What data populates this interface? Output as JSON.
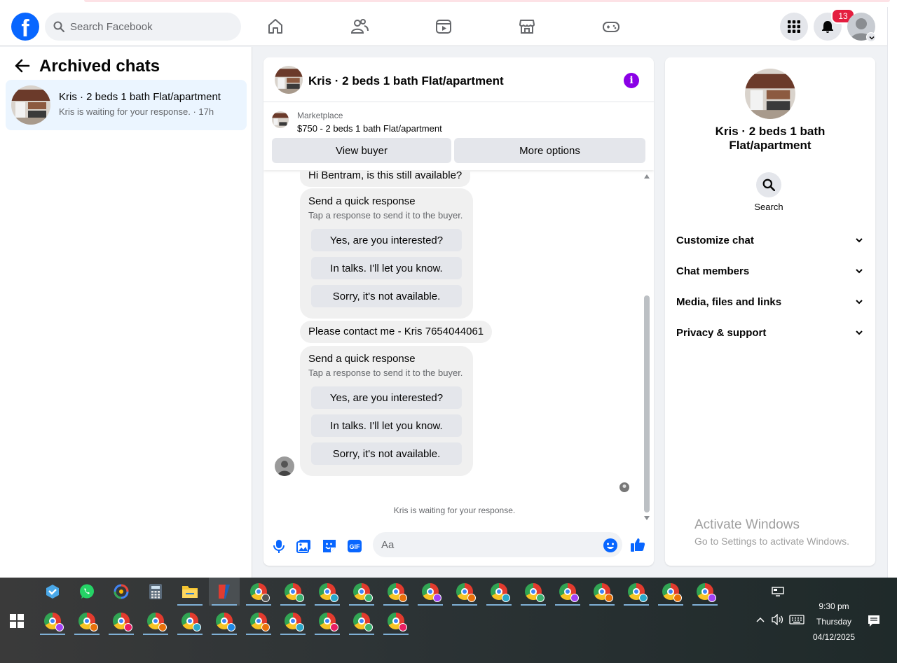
{
  "header": {
    "search_placeholder": "Search Facebook",
    "notification_count": "13",
    "logo_letter": "f"
  },
  "sidebar": {
    "title": "Archived chats",
    "chats": [
      {
        "name": "Kris · 2 beds 1 bath Flat/apartment",
        "preview": "Kris is waiting for your response. · 17h"
      }
    ]
  },
  "conversation": {
    "title": "Kris · 2 beds 1 bath Flat/apartment",
    "marketplace": {
      "label": "Marketplace",
      "listing": "$750 - 2 beds 1 bath Flat/apartment",
      "view_buyer": "View buyer",
      "more_options": "More options"
    },
    "messages": {
      "first": "Hi Bentram, is this still available?",
      "second": "Please contact me - Kris 7654044061"
    },
    "quick_response": {
      "title": "Send a quick response",
      "subtitle": "Tap a response to send it to the buyer.",
      "options": [
        "Yes, are you interested?",
        "In talks. I'll let you know.",
        "Sorry, it's not available."
      ]
    },
    "status": "Kris is waiting for your response.",
    "composer_placeholder": "Aa"
  },
  "right_panel": {
    "title": "Kris · 2 beds 1 bath Flat/apartment",
    "search_label": "Search",
    "sections": [
      "Customize chat",
      "Chat members",
      "Media, files and links",
      "Privacy & support"
    ]
  },
  "watermark": {
    "line1": "Activate Windows",
    "line2": "Go to Settings to activate Windows."
  },
  "taskbar": {
    "time": "9:30 pm",
    "day": "Thursday",
    "date": "04/12/2025"
  },
  "colors": {
    "facebook_blue": "#0866ff",
    "info_purple": "#8a00e6",
    "selected_chat_bg": "#ebf5ff",
    "badge_red": "#e41e3f"
  }
}
